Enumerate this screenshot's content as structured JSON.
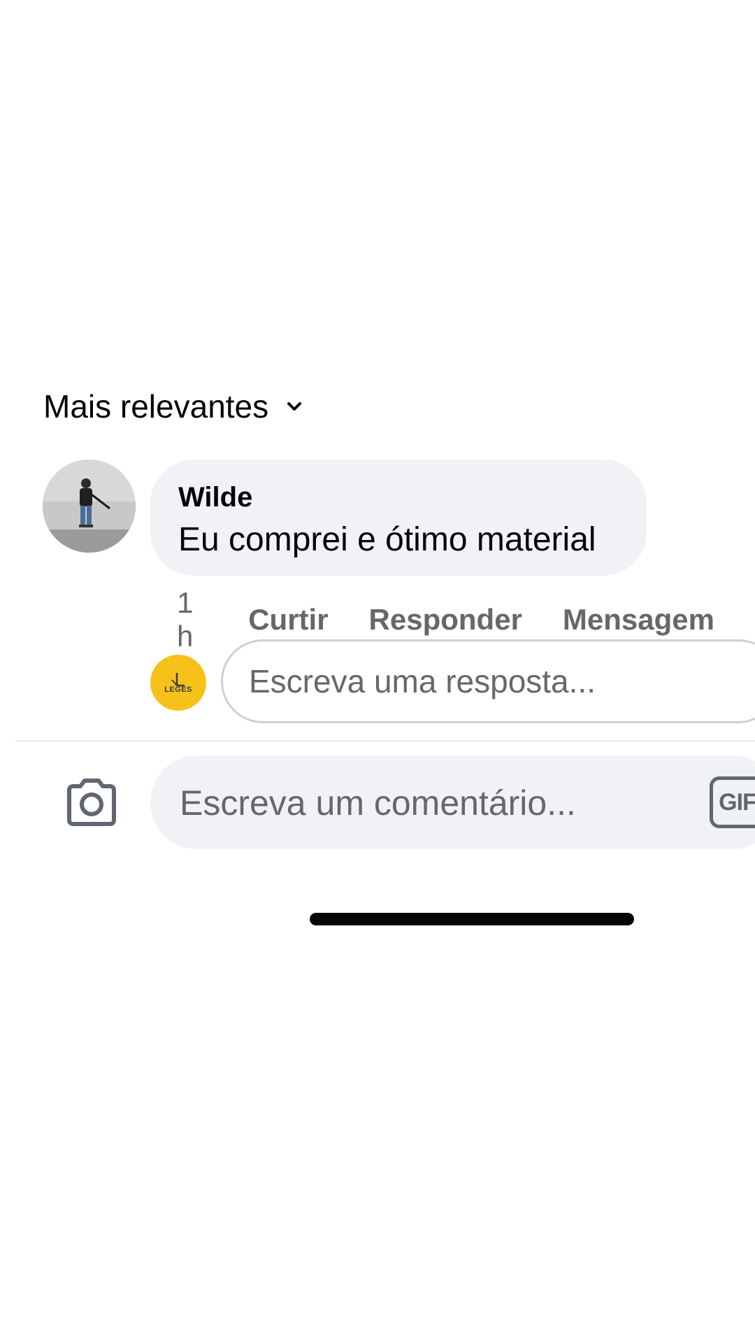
{
  "sort": {
    "label": "Mais relevantes",
    "icon": "chevron-down-icon"
  },
  "comment": {
    "author": "Wilde",
    "text": "Eu comprei e ótimo material",
    "time": "1 h",
    "actions": {
      "like": "Curtir",
      "reply": "Responder",
      "message": "Mensagem"
    }
  },
  "reply": {
    "avatar_logo_text": "LEGES",
    "placeholder": "Escreva uma resposta..."
  },
  "composer": {
    "camera_icon": "camera-icon",
    "placeholder": "Escreva um comentário...",
    "gif_label": "GIF"
  },
  "colors": {
    "bubble": "#f0f2f5",
    "secondary_text": "#65676b",
    "logo_yellow": "#f6c21a"
  }
}
